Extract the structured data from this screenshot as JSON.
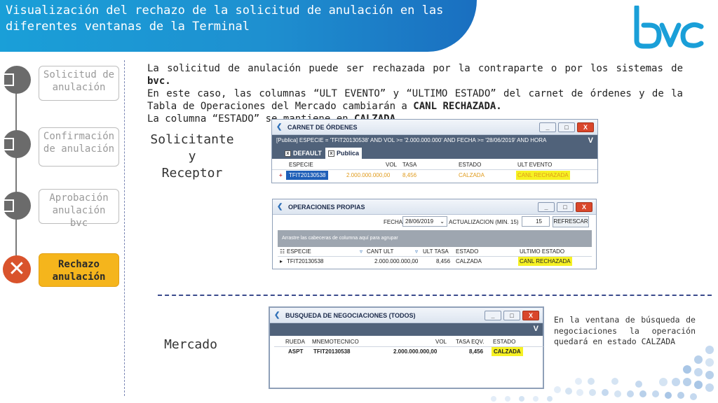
{
  "header": {
    "title": "Visualización del rechazo de la solicitud de anulación en las diferentes ventanas de la Terminal"
  },
  "logo": {
    "text": "bvc",
    "color": "#1a9fd8"
  },
  "steps": [
    {
      "label": "Solicitud de anulación",
      "state": "inactive"
    },
    {
      "label": "Confirmación de anulación",
      "state": "inactive"
    },
    {
      "label": "Aprobación anulación bvc",
      "state": "inactive"
    },
    {
      "label": "Rechazo anulación",
      "state": "active"
    }
  ],
  "intro": {
    "line1": "La solicitud de anulación puede ser rechazada por la contraparte o por los sistemas de ",
    "bvc": "bvc.",
    "line2a": "En este caso, las columnas “ULT EVENTO” y “ULTIMO ESTADO” del carnet de órdenes y de la Tabla de Operaciones del Mercado cambiarán a ",
    "canl": "CANL RECHAZADA.",
    "line3a": "La columna “ESTADO” se mantiene en ",
    "calzada": "CALZADA."
  },
  "labels": {
    "solicitante": "Solicitante",
    "y": "y",
    "receptor": "Receptor",
    "mercado": "Mercado"
  },
  "carnet": {
    "title": "CARNET DE ÓRDENES",
    "filter": "[Publica] ESPECIE = 'TFIT20130538' AND VOL >= '2.000.000.000' AND FECHA >= '28/06/2019' AND HORA",
    "tabs": [
      "DEFAULT",
      "Publica"
    ],
    "columns": [
      "ESPECIE",
      "VOL",
      "TASA",
      "ESTADO",
      "ULT EVENTO"
    ],
    "row": {
      "especie": "TFIT20130538",
      "vol": "2.000.000.000,00",
      "tasa": "8,456",
      "estado": "CALZADA",
      "ult_evento": "CANL RECHAZADA"
    }
  },
  "operaciones": {
    "title": "OPERACIONES PROPIAS",
    "fecha_label": "FECHA",
    "fecha_value": "28/06/2019",
    "act_label": "ACTUALIZACION (MIN. 15)",
    "act_value": "15",
    "refresh": "REFRESCAR",
    "drop_hint": "Arrastre las cabeceras de columna aquí para agrupar",
    "columns": [
      "ESPECIE",
      "CANT ULT",
      "ULT TASA",
      "ESTADO",
      "ULTIMO ESTADO"
    ],
    "row": {
      "especie": "TFIT20130538",
      "cant": "2.000.000.000,00",
      "tasa": "8,456",
      "estado": "CALZADA",
      "ultimo": "CANL RECHAZADA"
    }
  },
  "busqueda": {
    "title": "BUSQUEDA DE NEGOCIACIONES (TODOS)",
    "columns": [
      "RUEDA",
      "MNEMOTECNICO",
      "VOL",
      "TASA EQV.",
      "ESTADO"
    ],
    "row": {
      "rueda": "ASPT",
      "mnemo": "TFIT20130538",
      "vol": "2.000.000.000,00",
      "tasa": "8,456",
      "estado": "CALZADA"
    }
  },
  "note": {
    "text": "En la ventana de búsqueda de negociaciones la operación quedará en estado ",
    "bold": "CALZADA"
  },
  "window_buttons": {
    "min": "_",
    "max": "□",
    "close": "X"
  },
  "colors": {
    "accent": "#1a9fd8",
    "active_step": "#f5b51c",
    "reject": "#d9532c",
    "highlight": "#f6f123"
  }
}
